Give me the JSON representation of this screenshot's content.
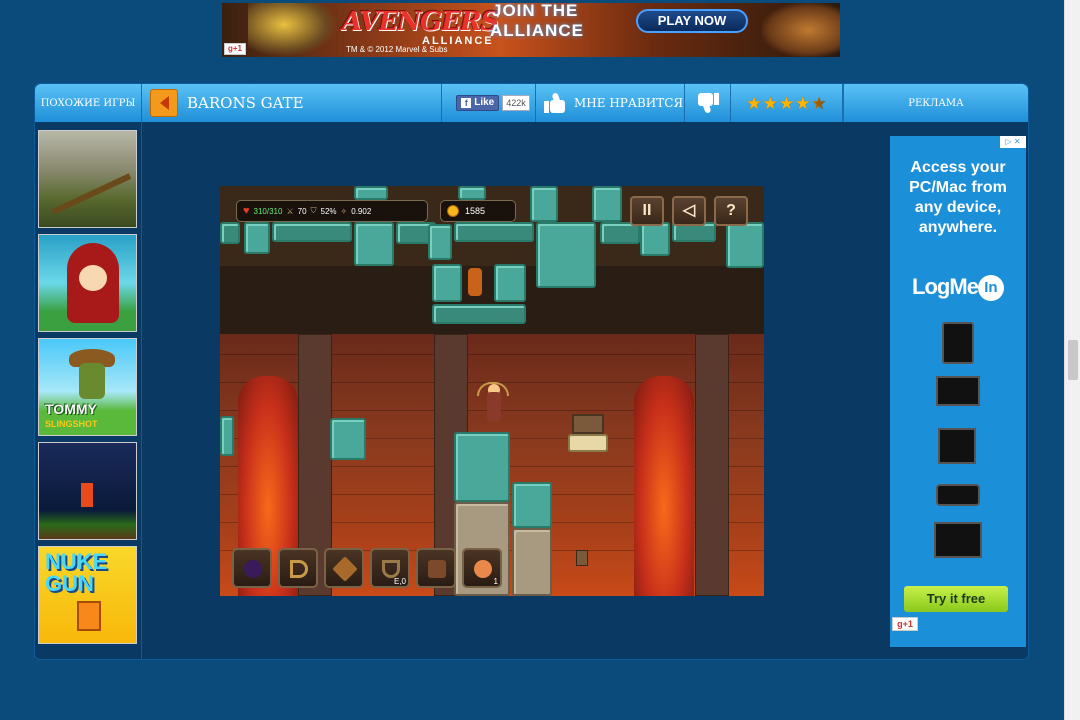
{
  "top_ad": {
    "brand": "AVENGERS",
    "brand_sub": "ALLIANCE",
    "copyright": "TM & © 2012 Marvel & Subs",
    "join": "JOIN THE",
    "alliance": "ALLIANCE",
    "cta": "PLAY NOW",
    "gplus": "g+1"
  },
  "header": {
    "similar_games": "ПОХОЖИЕ ИГРЫ",
    "game_title": "BARONS GATE",
    "fb_like": "Like",
    "fb_count": "422k",
    "like_label": "МНЕ НРАВИТСЯ",
    "rating_stars": 4.5,
    "ad_label": "РЕКЛАМА"
  },
  "similar_games": [
    {
      "name": "fishing-game"
    },
    {
      "name": "red-hood-game"
    },
    {
      "name": "tommy-slingshot",
      "logo": "TOMMY",
      "logo_sub": "SLINGSHOT"
    },
    {
      "name": "pixel-adventure-game"
    },
    {
      "name": "nuke-gun",
      "logo": "NUKE GUN"
    }
  ],
  "game": {
    "hp": "310/310",
    "attack": "70",
    "defense": "52%",
    "speed": "0.902",
    "coins": "1585",
    "buttons": {
      "pause": "II",
      "sound": "◁",
      "help": "?"
    },
    "toolbar": [
      {
        "item": "bomb",
        "qty": ""
      },
      {
        "item": "bow",
        "qty": ""
      },
      {
        "item": "arrow",
        "qty": ""
      },
      {
        "item": "crossbow",
        "qty": "E,0"
      },
      {
        "item": "boot",
        "qty": ""
      },
      {
        "item": "potion",
        "qty": "1"
      }
    ]
  },
  "right_ad": {
    "adchoices": "▷ ✕",
    "line1": "Access your",
    "line2": "PC/Mac from",
    "line3": "any device,",
    "line4": "anywhere.",
    "logo": "LogMe",
    "logo_in": "In",
    "cta": "Try it free",
    "gplus": "g+1"
  },
  "colors": {
    "page_bg": "#0b4b7c",
    "header_top": "#5ac2f5",
    "header_bottom": "#1f8fd8",
    "back_button": "#f39a1c",
    "star": "#ffb400",
    "ad_bg": "#1b8fd8",
    "try_button": "#a8e03a"
  }
}
